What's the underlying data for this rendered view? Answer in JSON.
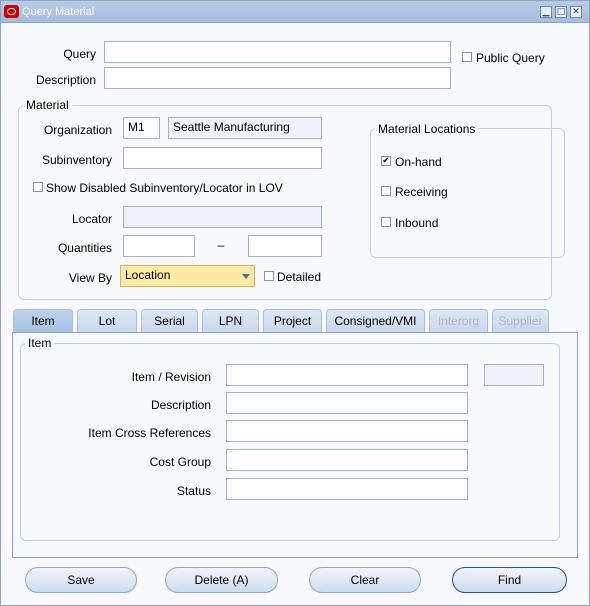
{
  "window": {
    "title": "Query Material",
    "min_symbol": "▁",
    "max_symbol": "□",
    "close_symbol": "✕"
  },
  "query": {
    "query_label": "Query",
    "query_value": "",
    "description_label": "Description",
    "description_value": "",
    "public_query_label": "Public Query",
    "public_query_checked": false
  },
  "material": {
    "group_title": "Material",
    "organization_label": "Organization",
    "organization_code": "M1",
    "organization_name": "Seattle Manufacturing",
    "subinventory_label": "Subinventory",
    "subinventory_value": "",
    "show_disabled_label": "Show Disabled Subinventory/Locator in LOV",
    "show_disabled_checked": false,
    "locator_label": "Locator",
    "locator_value": "",
    "quantities_label": "Quantities",
    "quantities_from": "",
    "quantities_dash": "–",
    "quantities_to": "",
    "view_by_label": "View By",
    "view_by_value": "Location",
    "detailed_label": "Detailed",
    "detailed_checked": false
  },
  "material_locations": {
    "group_title": "Material Locations",
    "items": [
      {
        "label": "On-hand",
        "checked": true,
        "mark": "✔"
      },
      {
        "label": "Receiving",
        "checked": false,
        "mark": ""
      },
      {
        "label": "Inbound",
        "checked": false,
        "mark": ""
      }
    ]
  },
  "tabs": [
    {
      "label": "Item",
      "state": "active"
    },
    {
      "label": "Lot",
      "state": "normal"
    },
    {
      "label": "Serial",
      "state": "normal"
    },
    {
      "label": "LPN",
      "state": "normal"
    },
    {
      "label": "Project",
      "state": "normal"
    },
    {
      "label": "Consigned/VMI",
      "state": "normal"
    },
    {
      "label": "Interorg",
      "state": "disabled"
    },
    {
      "label": "Supplier",
      "state": "disabled"
    }
  ],
  "item_panel": {
    "group_title": "Item",
    "item_revision_label": "Item / Revision",
    "item_value": "",
    "revision_value": "",
    "description_label": "Description",
    "description_value": "",
    "cross_ref_label": "Item Cross References",
    "cross_ref_value": "",
    "cost_group_label": "Cost Group",
    "cost_group_value": "",
    "status_label": "Status",
    "status_value": ""
  },
  "buttons": {
    "save": "Save",
    "delete": "Delete (A)",
    "clear": "Clear",
    "find": "Find"
  },
  "colors": {
    "titlebar": "#a7bddf",
    "view_by_highlight": "#fbe9a6",
    "tab_bg": "#c8d7ec",
    "disabled_text": "#b1b8c4"
  }
}
